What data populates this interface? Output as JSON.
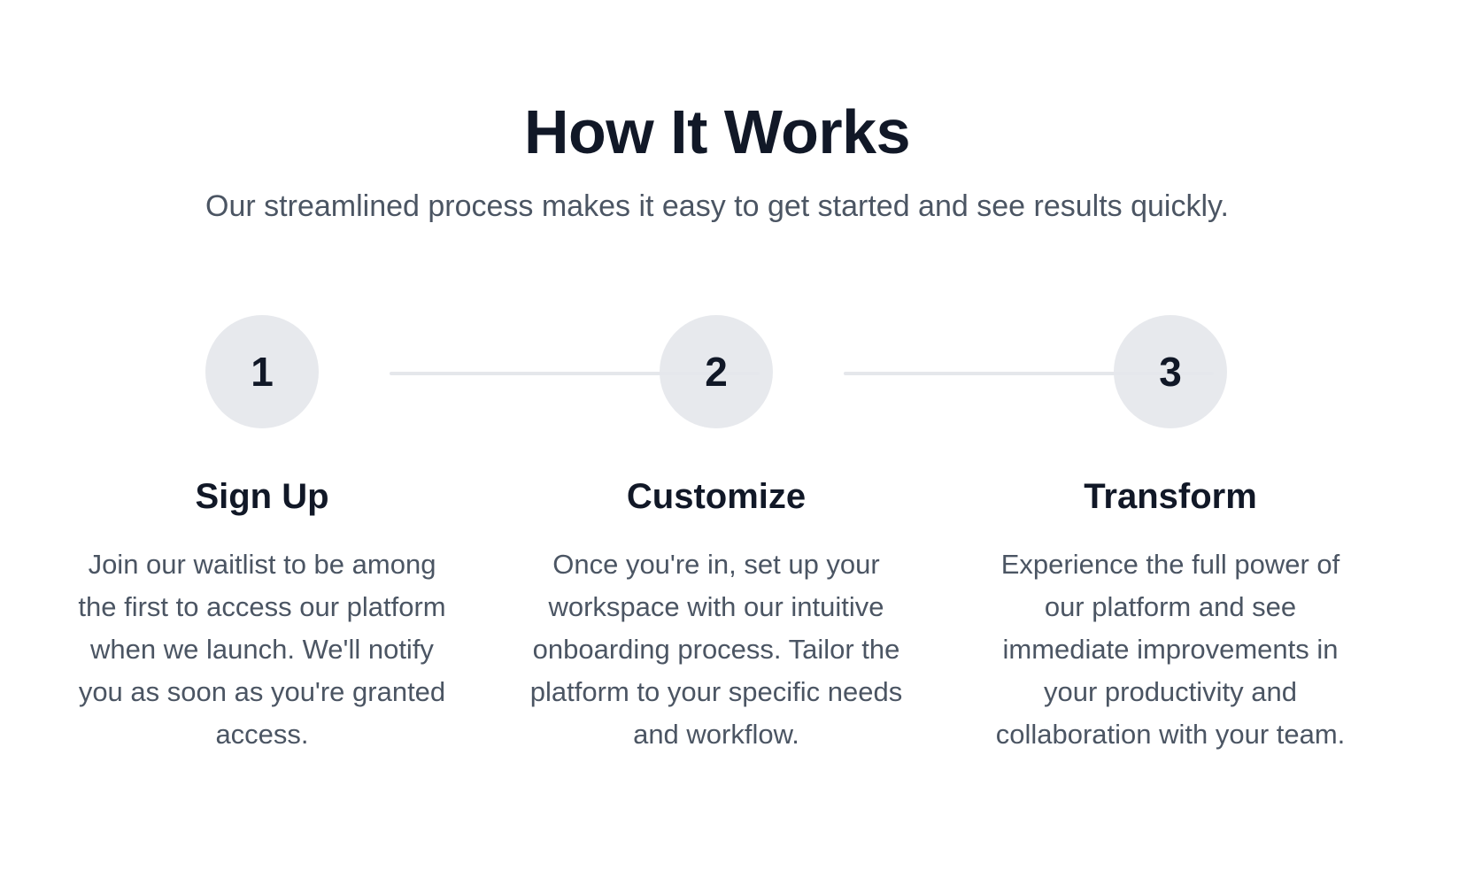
{
  "header": {
    "title": "How It Works",
    "subtitle": "Our streamlined process makes it easy to get started and see results quickly."
  },
  "steps": [
    {
      "number": "1",
      "title": "Sign Up",
      "description": "Join our waitlist to be among the first to access our platform when we launch. We'll notify you as soon as you're granted access."
    },
    {
      "number": "2",
      "title": "Customize",
      "description": "Once you're in, set up your workspace with our intuitive onboarding process. Tailor the platform to your specific needs and workflow."
    },
    {
      "number": "3",
      "title": "Transform",
      "description": "Experience the full power of our platform and see immediate improvements in your productivity and collaboration with your team."
    }
  ],
  "colors": {
    "heading": "#111827",
    "body_text": "#4b5563",
    "circle_bg": "#e5e7eb",
    "connector": "#e5e7eb",
    "background": "#ffffff"
  }
}
